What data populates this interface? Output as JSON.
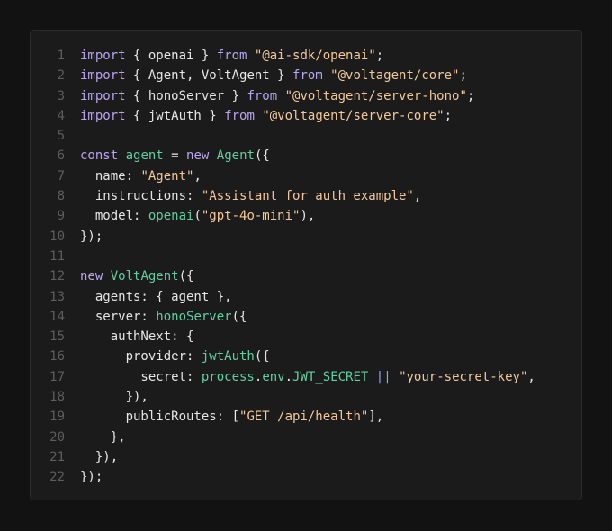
{
  "editor": {
    "line_numbers": [
      "1",
      "2",
      "3",
      "4",
      "5",
      "6",
      "7",
      "8",
      "9",
      "10",
      "11",
      "12",
      "13",
      "14",
      "15",
      "16",
      "17",
      "18",
      "19",
      "20",
      "21",
      "22"
    ],
    "lines": [
      [
        {
          "t": "import",
          "c": "k"
        },
        {
          "t": " { openai } ",
          "c": "p"
        },
        {
          "t": "from",
          "c": "k"
        },
        {
          "t": " ",
          "c": "p"
        },
        {
          "t": "\"@ai-sdk/openai\"",
          "c": "s"
        },
        {
          "t": ";",
          "c": "p"
        }
      ],
      [
        {
          "t": "import",
          "c": "k"
        },
        {
          "t": " { Agent, VoltAgent } ",
          "c": "p"
        },
        {
          "t": "from",
          "c": "k"
        },
        {
          "t": " ",
          "c": "p"
        },
        {
          "t": "\"@voltagent/core\"",
          "c": "s"
        },
        {
          "t": ";",
          "c": "p"
        }
      ],
      [
        {
          "t": "import",
          "c": "k"
        },
        {
          "t": " { honoServer } ",
          "c": "p"
        },
        {
          "t": "from",
          "c": "k"
        },
        {
          "t": " ",
          "c": "p"
        },
        {
          "t": "\"@voltagent/server-hono\"",
          "c": "s"
        },
        {
          "t": ";",
          "c": "p"
        }
      ],
      [
        {
          "t": "import",
          "c": "k"
        },
        {
          "t": " { jwtAuth } ",
          "c": "p"
        },
        {
          "t": "from",
          "c": "k"
        },
        {
          "t": " ",
          "c": "p"
        },
        {
          "t": "\"@voltagent/server-core\"",
          "c": "s"
        },
        {
          "t": ";",
          "c": "p"
        }
      ],
      [],
      [
        {
          "t": "const",
          "c": "k"
        },
        {
          "t": " ",
          "c": "p"
        },
        {
          "t": "agent",
          "c": "v"
        },
        {
          "t": " = ",
          "c": "p"
        },
        {
          "t": "new",
          "c": "k"
        },
        {
          "t": " ",
          "c": "p"
        },
        {
          "t": "Agent",
          "c": "f"
        },
        {
          "t": "({",
          "c": "p"
        }
      ],
      [
        {
          "t": "  name: ",
          "c": "p"
        },
        {
          "t": "\"Agent\"",
          "c": "s"
        },
        {
          "t": ",",
          "c": "p"
        }
      ],
      [
        {
          "t": "  instructions: ",
          "c": "p"
        },
        {
          "t": "\"Assistant for auth example\"",
          "c": "s"
        },
        {
          "t": ",",
          "c": "p"
        }
      ],
      [
        {
          "t": "  model: ",
          "c": "p"
        },
        {
          "t": "openai",
          "c": "f"
        },
        {
          "t": "(",
          "c": "p"
        },
        {
          "t": "\"gpt-4o-mini\"",
          "c": "s"
        },
        {
          "t": "),",
          "c": "p"
        }
      ],
      [
        {
          "t": "});",
          "c": "p"
        }
      ],
      [],
      [
        {
          "t": "new",
          "c": "k"
        },
        {
          "t": " ",
          "c": "p"
        },
        {
          "t": "VoltAgent",
          "c": "f"
        },
        {
          "t": "({",
          "c": "p"
        }
      ],
      [
        {
          "t": "  agents: { agent },",
          "c": "p"
        }
      ],
      [
        {
          "t": "  server: ",
          "c": "p"
        },
        {
          "t": "honoServer",
          "c": "f"
        },
        {
          "t": "({",
          "c": "p"
        }
      ],
      [
        {
          "t": "    authNext: {",
          "c": "p"
        }
      ],
      [
        {
          "t": "      provider: ",
          "c": "p"
        },
        {
          "t": "jwtAuth",
          "c": "f"
        },
        {
          "t": "({",
          "c": "p"
        }
      ],
      [
        {
          "t": "        secret: ",
          "c": "p"
        },
        {
          "t": "process",
          "c": "v"
        },
        {
          "t": ".",
          "c": "p"
        },
        {
          "t": "env",
          "c": "v"
        },
        {
          "t": ".",
          "c": "p"
        },
        {
          "t": "JWT_SECRET",
          "c": "v"
        },
        {
          "t": " ",
          "c": "p"
        },
        {
          "t": "||",
          "c": "op"
        },
        {
          "t": " ",
          "c": "p"
        },
        {
          "t": "\"your-secret-key\"",
          "c": "s"
        },
        {
          "t": ",",
          "c": "p"
        }
      ],
      [
        {
          "t": "      }),",
          "c": "p"
        }
      ],
      [
        {
          "t": "      publicRoutes: [",
          "c": "p"
        },
        {
          "t": "\"GET /api/health\"",
          "c": "s"
        },
        {
          "t": "],",
          "c": "p"
        }
      ],
      [
        {
          "t": "    },",
          "c": "p"
        }
      ],
      [
        {
          "t": "  }),",
          "c": "p"
        }
      ],
      [
        {
          "t": "});",
          "c": "p"
        }
      ]
    ]
  },
  "colors": {
    "background": "#121212",
    "panel": "#1b1b1b",
    "keyword": "#b6a6f0",
    "string": "#f3c89a",
    "function": "#5fd0a0",
    "operator": "#8fa3f5",
    "text": "#e6e6e6",
    "line_number": "#5d5d5d"
  }
}
